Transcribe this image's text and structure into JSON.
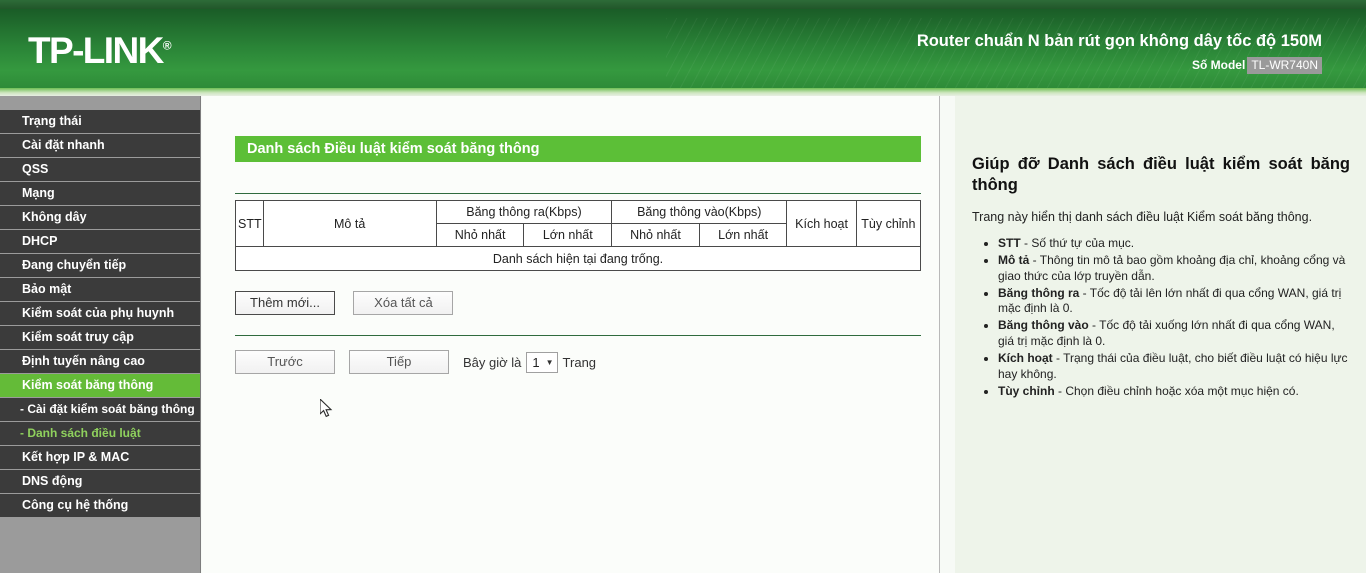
{
  "header": {
    "logo": "TP-LINK",
    "logo_reg": "®",
    "model_desc": "Router chuẩn N bản rút gọn không dây tốc độ 150M",
    "model_label": "Số Model",
    "model_number": "TL-WR740N",
    "brand_green": "#2a8437"
  },
  "sidebar": {
    "items": [
      {
        "label": "Trạng thái",
        "state": "normal"
      },
      {
        "label": "Cài đặt nhanh",
        "state": "normal"
      },
      {
        "label": "QSS",
        "state": "normal"
      },
      {
        "label": "Mạng",
        "state": "normal"
      },
      {
        "label": "Không dây",
        "state": "normal"
      },
      {
        "label": "DHCP",
        "state": "normal"
      },
      {
        "label": "Đang chuyển tiếp",
        "state": "normal"
      },
      {
        "label": "Bảo mật",
        "state": "normal"
      },
      {
        "label": "Kiểm soát của phụ huynh",
        "state": "normal"
      },
      {
        "label": "Kiểm soát truy cập",
        "state": "normal"
      },
      {
        "label": "Định tuyến nâng cao",
        "state": "normal"
      },
      {
        "label": "Kiểm soát băng thông",
        "state": "active"
      },
      {
        "label": "- Cài đặt kiểm soát băng thông",
        "state": "sub"
      },
      {
        "label": "- Danh sách điều luật",
        "state": "sub-active"
      },
      {
        "label": "Kết hợp IP & MAC",
        "state": "normal"
      },
      {
        "label": "DNS động",
        "state": "normal"
      },
      {
        "label": "Công cụ hệ thống",
        "state": "normal"
      }
    ],
    "active_color": "#64bb38",
    "sub_active_color": "#8fd15d"
  },
  "main": {
    "page_title": "Danh sách Điều luật kiểm soát băng thông",
    "table": {
      "col_stt": "STT",
      "col_desc": "Mô tả",
      "group_out": "Băng thông ra(Kbps)",
      "group_in": "Băng thông vào(Kbps)",
      "sub_min_out": "Nhỏ nhất",
      "sub_max_out": "Lớn nhất",
      "sub_min_in": "Nhỏ nhất",
      "sub_max_in": "Lớn nhất",
      "col_enable": "Kích hoạt",
      "col_modify": "Tùy chỉnh",
      "empty_message": "Danh sách hiện tại đang trống.",
      "rows": []
    },
    "buttons": {
      "add_new": "Thêm mới...",
      "delete_all": "Xóa tất cả",
      "previous": "Trước",
      "next": "Tiếp"
    },
    "pager": {
      "prefix": "Bây giờ là",
      "current_page": "1",
      "suffix": "Trang"
    }
  },
  "help": {
    "title": "Giúp đỡ Danh sách điều luật kiểm soát băng thông",
    "intro": "Trang này hiển thị danh sách điều luật Kiểm soát băng thông.",
    "items": [
      {
        "term": "STT",
        "desc": " - Số thứ tự của mục."
      },
      {
        "term": "Mô tả",
        "desc": " - Thông tin mô tả bao gồm khoảng địa chỉ, khoảng cổng và giao thức của lớp truyền dẫn."
      },
      {
        "term": "Băng thông ra",
        "desc": " - Tốc độ tải lên lớn nhất đi qua cổng WAN, giá trị mặc định là 0."
      },
      {
        "term": "Băng thông vào",
        "desc": " - Tốc độ tải xuống lớn nhất đi qua cổng WAN, giá trị mặc định là 0."
      },
      {
        "term": "Kích hoạt",
        "desc": " - Trạng thái của điều luật, cho biết điều luật có hiệu lực hay không."
      },
      {
        "term": "Tùy chỉnh",
        "desc": " - Chọn điều chỉnh hoặc xóa một mục hiện có."
      }
    ]
  },
  "cursor": {
    "icon": "arrow-pointer"
  }
}
